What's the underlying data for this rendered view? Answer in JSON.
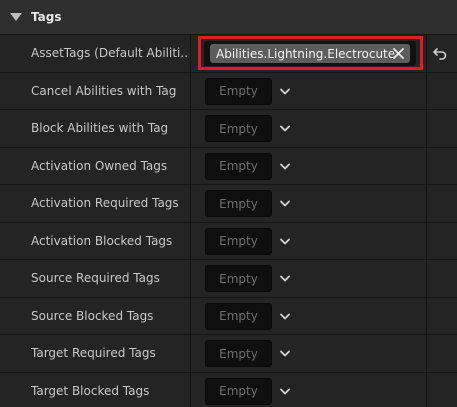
{
  "section": {
    "title": "Tags",
    "icon": "collapse-arrow-icon"
  },
  "rows": [
    {
      "label": "AssetTags (Default Abiliti...",
      "tag": "Abilities.Lightning.Electrocute"
    },
    {
      "label": "Cancel Abilities with Tag",
      "value": "Empty"
    },
    {
      "label": "Block Abilities with Tag",
      "value": "Empty"
    },
    {
      "label": "Activation Owned Tags",
      "value": "Empty"
    },
    {
      "label": "Activation Required Tags",
      "value": "Empty"
    },
    {
      "label": "Activation Blocked Tags",
      "value": "Empty"
    },
    {
      "label": "Source Required Tags",
      "value": "Empty"
    },
    {
      "label": "Source Blocked Tags",
      "value": "Empty"
    },
    {
      "label": "Target Required Tags",
      "value": "Empty"
    },
    {
      "label": "Target Blocked Tags",
      "value": "Empty"
    }
  ],
  "colors": {
    "highlight": "#e01c22",
    "chip": "#5d5d5d"
  },
  "icons": {
    "remove": "close-icon",
    "dropdown": "chevron-down-icon",
    "reset": "reset-arrow-icon"
  }
}
